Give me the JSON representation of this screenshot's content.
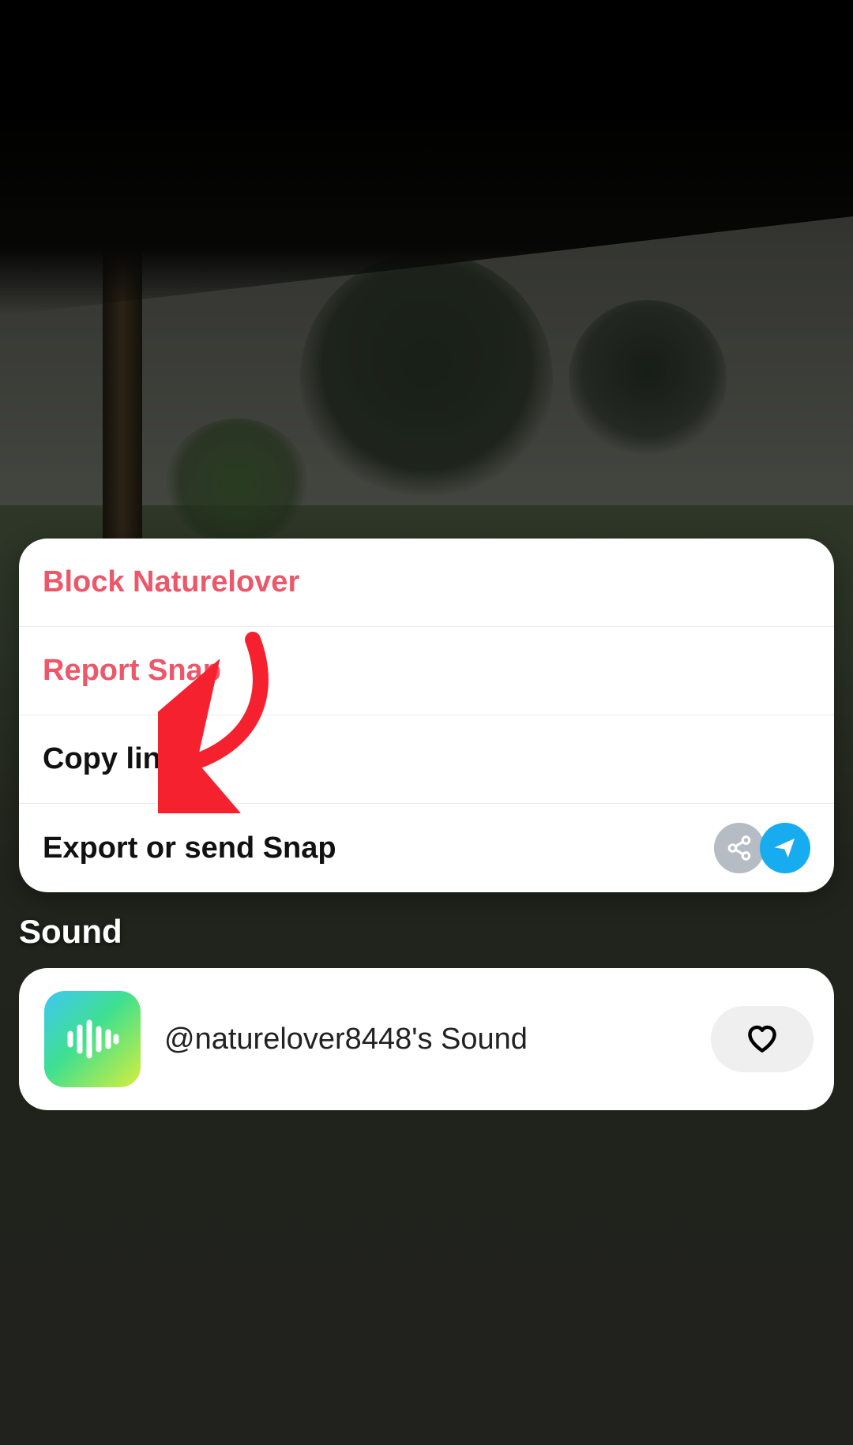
{
  "actions": {
    "block": "Block Naturelover",
    "report": "Report Snap",
    "copy_link": "Copy link",
    "export": "Export or send Snap"
  },
  "sound": {
    "section_title": "Sound",
    "label": "@naturelover8448's Sound"
  },
  "icons": {
    "share": "share-icon",
    "send": "send-icon",
    "heart": "heart-icon",
    "waveform": "waveform-icon"
  },
  "annotation": {
    "arrow_color": "#f6212e"
  }
}
